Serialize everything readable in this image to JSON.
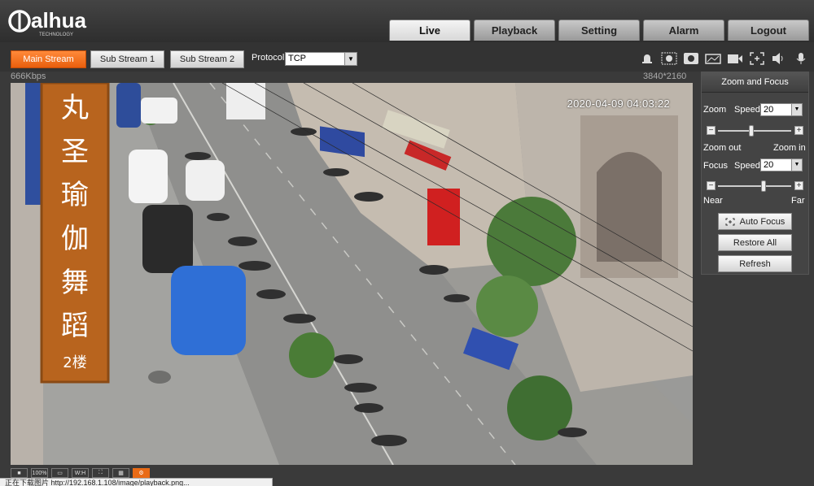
{
  "brand": {
    "logo_text": "alhua",
    "logo_sub": "TECHNOLOGY"
  },
  "nav": {
    "tabs": [
      {
        "label": "Live",
        "active": true
      },
      {
        "label": "Playback",
        "active": false
      },
      {
        "label": "Setting",
        "active": false
      },
      {
        "label": "Alarm",
        "active": false
      },
      {
        "label": "Logout",
        "active": false
      }
    ]
  },
  "toolbar": {
    "streams": [
      {
        "label": "Main Stream",
        "active": true
      },
      {
        "label": "Sub Stream 1",
        "active": false
      },
      {
        "label": "Sub Stream 2",
        "active": false
      }
    ],
    "protocol_label": "Protocol",
    "protocol_value": "TCP",
    "icons": [
      "alarm-light-icon",
      "fit-screen-icon",
      "snapshot-icon",
      "image-tool-icon",
      "record-icon",
      "digital-zoom-icon",
      "audio-icon",
      "microphone-icon"
    ]
  },
  "video": {
    "bitrate": "666Kbps",
    "resolution": "3840*2160",
    "timestamp": "2020-04-09 04:03:22",
    "sign_chars": [
      "丸",
      "圣",
      "瑜",
      "伽",
      "舞",
      "蹈",
      "2楼"
    ]
  },
  "ptz": {
    "title": "Zoom and Focus",
    "zoom_label": "Zoom",
    "speed_label": "Speed",
    "zoom_speed": "20",
    "zoom_out_label": "Zoom out",
    "zoom_in_label": "Zoom in",
    "focus_label": "Focus",
    "focus_speed": "20",
    "near_label": "Near",
    "far_label": "Far",
    "zoom_level": 0.45,
    "focus_level": 0.62,
    "buttons": {
      "auto_focus": "Auto Focus",
      "restore_all": "Restore All",
      "refresh": "Refresh"
    }
  },
  "bottom": {
    "icons": [
      "lock-icon",
      "100%",
      "fit-icon",
      "W:H",
      "fullscreen-icon",
      "split-icon",
      "settings-icon"
    ],
    "status_text": "正在下载图片 http://192.168.1.108/image/playback.png..."
  },
  "colors": {
    "accent": "#e95f0d",
    "background": "#3a3a3a"
  }
}
